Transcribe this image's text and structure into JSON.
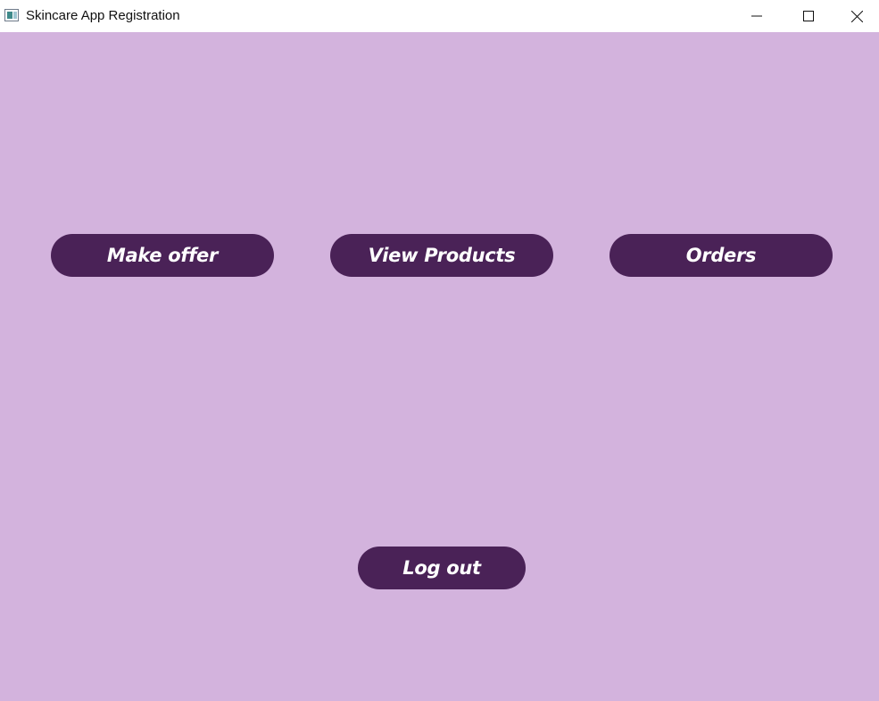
{
  "window": {
    "title": "Skincare App Registration",
    "icon": "app-window-icon",
    "controls": {
      "minimize_icon": "minimize-icon",
      "maximize_icon": "maximize-icon",
      "close_icon": "close-icon"
    }
  },
  "colors": {
    "background": "#d3b3dd",
    "button": "#4a2257",
    "button_text": "#ffffff",
    "titlebar": "#ffffff"
  },
  "actions": {
    "make_offer_label": "Make offer",
    "view_products_label": "View Products",
    "orders_label": "Orders",
    "logout_label": "Log out"
  }
}
